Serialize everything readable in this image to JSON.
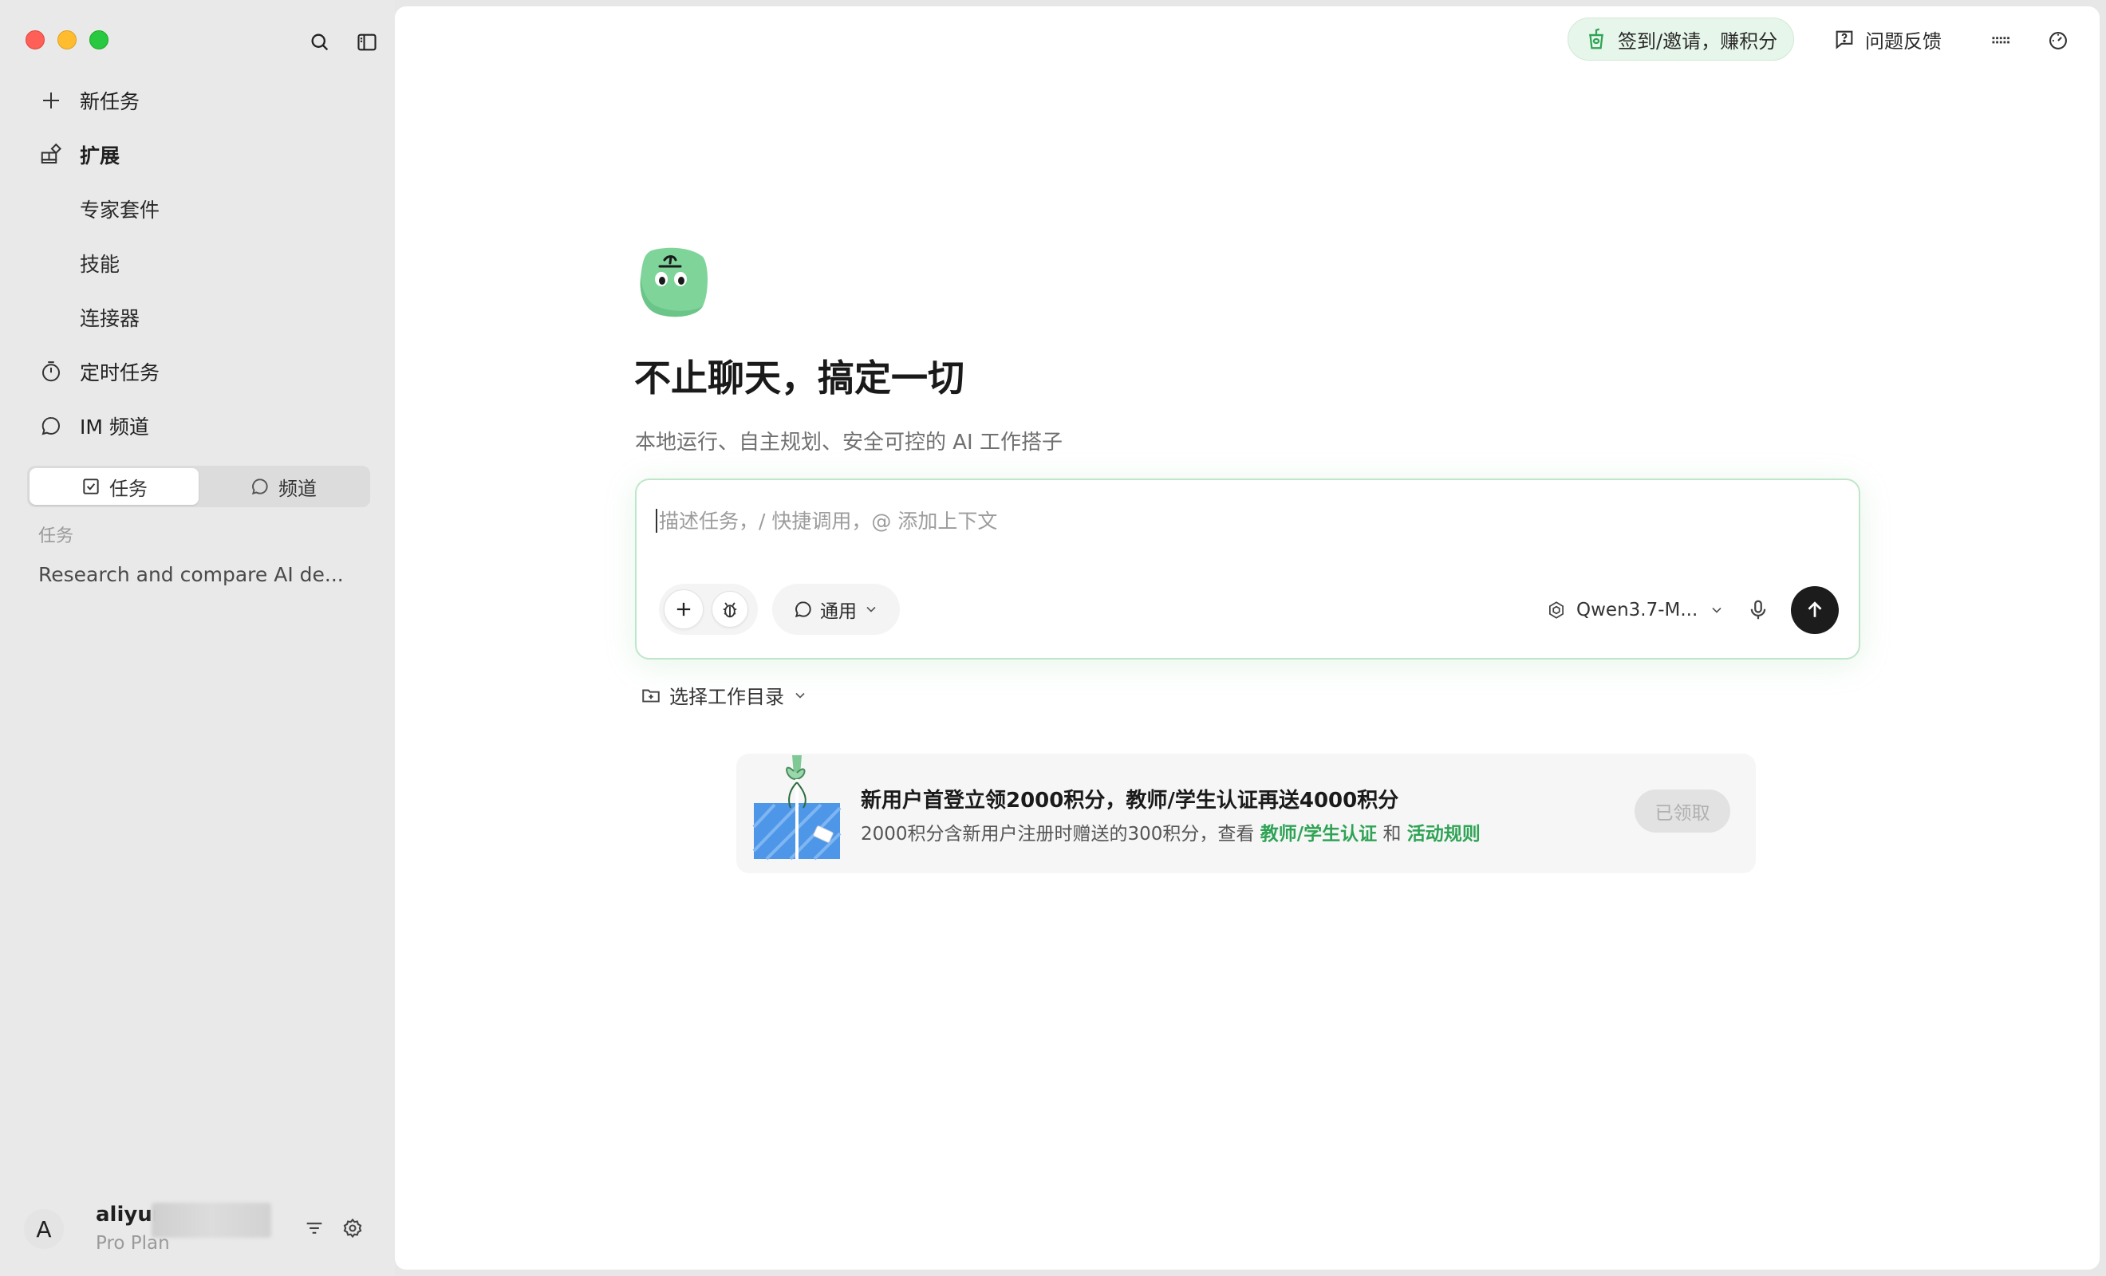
{
  "sidebar": {
    "nav": {
      "new_task": "新任务",
      "extend": "扩展",
      "expert_kit": "专家套件",
      "skills": "技能",
      "connectors": "连接器",
      "scheduled": "定时任务",
      "im_channel": "IM 频道"
    },
    "segment": {
      "tasks": "任务",
      "channels": "频道"
    },
    "section_label": "任务",
    "tasks": [
      "Research and compare AI de..."
    ],
    "profile": {
      "avatar_letter": "A",
      "name": "aliyur",
      "plan": "Pro Plan"
    }
  },
  "topbar": {
    "invite": "签到/邀请，赚积分",
    "feedback": "问题反馈"
  },
  "hero": {
    "title": "不止聊天，搞定一切",
    "subtitle": "本地运行、自主规划、安全可控的 AI 工作搭子"
  },
  "composer": {
    "placeholder": "描述任务，/ 快捷调用，@ 添加上下文",
    "mode": "通用",
    "model": "Qwen3.7-M..."
  },
  "workdir": {
    "label": "选择工作目录"
  },
  "promo": {
    "title": "新用户首登立领2000积分，教师/学生认证再送4000积分",
    "desc_prefix": "2000积分含新用户注册时赠送的300积分，查看",
    "link1": "教师/学生认证",
    "and": "和",
    "link2": "活动规则",
    "button": "已领取"
  },
  "colors": {
    "accent_green": "#2fa355",
    "invite_bg": "#e7f6ea",
    "send_bg": "#1c1c1c"
  }
}
